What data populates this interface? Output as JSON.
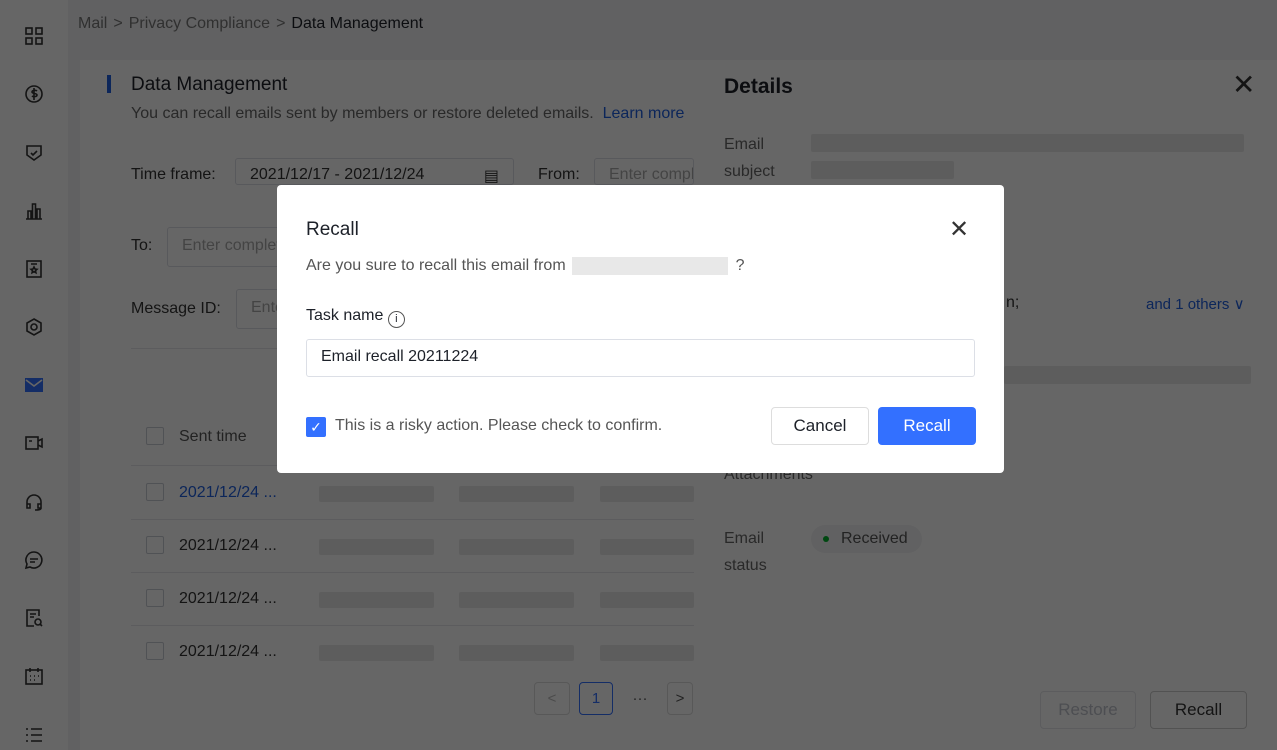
{
  "breadcrumb": [
    "Mail",
    "Privacy Compliance",
    "Data Management"
  ],
  "page": {
    "title": "Data Management",
    "description": "You can recall emails sent by members or restore deleted emails.",
    "learn_more": "Learn more"
  },
  "filters": {
    "time_frame_label": "Time frame:",
    "time_frame_value": "2021/12/17 - 2021/12/24",
    "from_label": "From:",
    "from_placeholder": "Enter complete address",
    "to_label": "To:",
    "to_placeholder": "Enter complete address",
    "message_id_label": "Message ID:",
    "message_id_placeholder": "Enter message ID"
  },
  "table": {
    "header": "Sent time",
    "rows": [
      "2021/12/24 ...",
      "2021/12/24 ...",
      "2021/12/24 ...",
      "2021/12/24 ..."
    ]
  },
  "pagination": {
    "current": "1",
    "ellipsis": "···",
    "prev": "<",
    "next": ">"
  },
  "details": {
    "title": "Details",
    "email_subject_label": "Email subject",
    "recipients_suffix": "n;",
    "and_others": "and 1 others",
    "attachments_label": "Attachments",
    "email_status_label": "Email status",
    "status": "Received",
    "status_color": "#00b42a",
    "restore": "Restore",
    "recall": "Recall"
  },
  "modal": {
    "title": "Recall",
    "question": "Are you sure to recall this email from",
    "question_mark": "?",
    "task_name_label": "Task name",
    "task_name_value": "Email recall 20211224",
    "confirm_text": "This is a risky action. Please check to confirm.",
    "confirm_checked": true,
    "cancel": "Cancel",
    "recall": "Recall",
    "accent": "#3370ff"
  },
  "sidebar": {
    "icons": [
      "grid-icon",
      "dollar-icon",
      "shield-icon",
      "chart-icon",
      "badge-icon",
      "settings-icon",
      "mail-icon",
      "video-icon",
      "headset-icon",
      "chat-icon",
      "document-search-icon",
      "calendar-icon",
      "list-icon"
    ],
    "active": "mail-icon"
  }
}
